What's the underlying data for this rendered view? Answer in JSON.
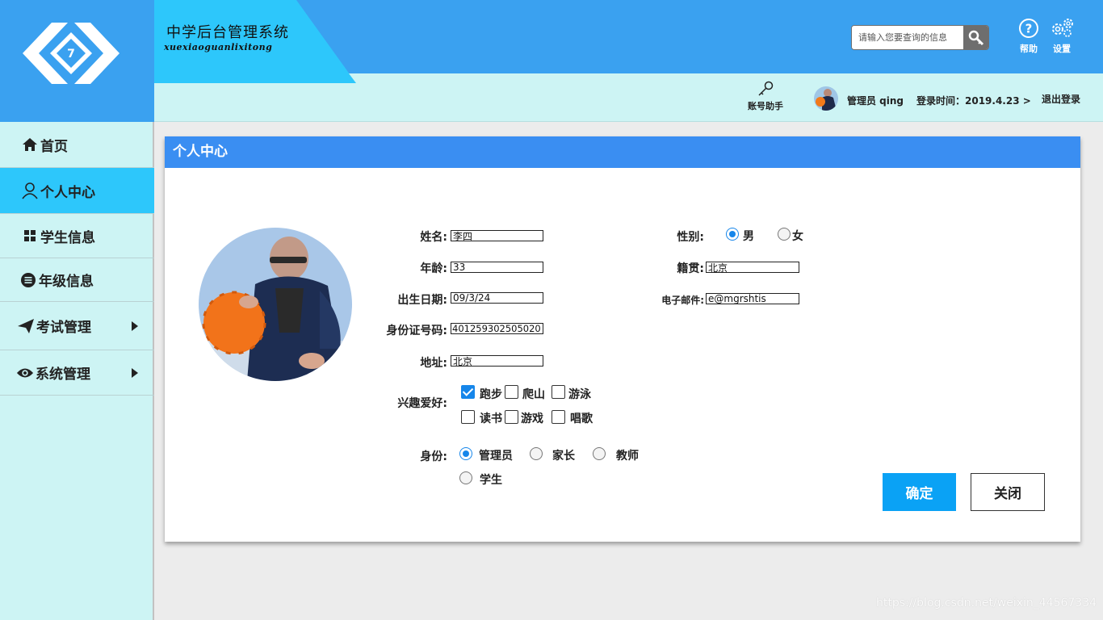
{
  "header": {
    "app_title": "中学后台管理系统",
    "app_subtitle": "xuexiaoguanlixitong",
    "search_placeholder": "请输入您要查询的信息",
    "help_label": "帮助",
    "settings_label": "设置",
    "account_helper_label": "账号助手",
    "admin_name": "管理员 qing",
    "login_time": "登录时间：2019.4.23 >",
    "logout_label": "退出登录"
  },
  "sidebar": {
    "items": [
      {
        "label": "首页",
        "icon": "home-icon",
        "active": false,
        "has_arrow": false
      },
      {
        "label": "个人中心",
        "icon": "user-icon",
        "active": true,
        "has_arrow": false
      },
      {
        "label": "学生信息",
        "icon": "grid-icon",
        "active": false,
        "has_arrow": false
      },
      {
        "label": "年级信息",
        "icon": "list-circle-icon",
        "active": false,
        "has_arrow": false
      },
      {
        "label": "考试管理",
        "icon": "paper-plane-icon",
        "active": false,
        "has_arrow": true
      },
      {
        "label": "系统管理",
        "icon": "eye-icon",
        "active": false,
        "has_arrow": true
      }
    ]
  },
  "panel": {
    "title": "个人中心",
    "form": {
      "name": {
        "label": "姓名:",
        "value": "李四"
      },
      "age": {
        "label": "年龄:",
        "value": "33"
      },
      "birth": {
        "label": "出生日期:",
        "value": "09/3/24"
      },
      "id_number": {
        "label": "身份证号码:",
        "value": "401259302505020"
      },
      "address": {
        "label": "地址:",
        "value": "北京"
      },
      "gender": {
        "label": "性别:",
        "options": [
          "男",
          "女"
        ],
        "selected": "男"
      },
      "native_place": {
        "label": "籍贯:",
        "value": "北京"
      },
      "email": {
        "label": "电子邮件:",
        "value": "e@mgrshtis"
      },
      "hobbies": {
        "label": "兴趣爱好:",
        "options": [
          "跑步",
          "爬山",
          "游泳",
          "读书",
          "游戏",
          "唱歌"
        ],
        "checked": [
          "跑步"
        ]
      },
      "role": {
        "label": "身份:",
        "options": [
          "管理员",
          "家长",
          "教师",
          "学生"
        ],
        "selected": "管理员"
      }
    },
    "confirm_label": "确定",
    "close_label": "关闭"
  },
  "colors": {
    "header_blue": "#3aa1f0",
    "title_tab": "#2dc7fb",
    "light_cyan": "#cdf4f4",
    "panel_head": "#3a8ef2",
    "confirm_blue": "#0aa2f5"
  },
  "watermark": "https://blog.csdn.net/weixin_44567334"
}
